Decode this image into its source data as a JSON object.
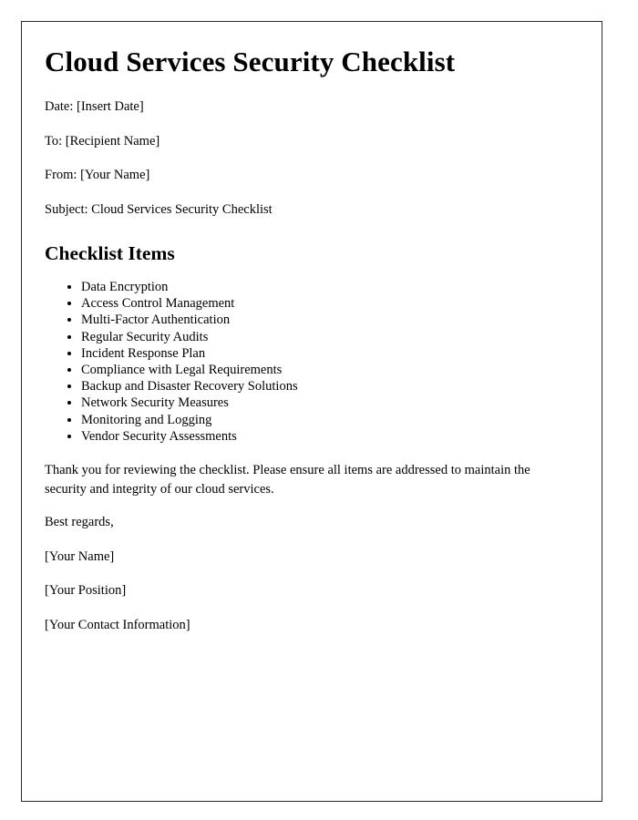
{
  "document": {
    "title": "Cloud Services Security Checklist",
    "meta_lines": [
      "Date: [Insert Date]",
      "To: [Recipient Name]",
      "From: [Your Name]",
      "Subject: Cloud Services Security Checklist"
    ],
    "section_heading": "Checklist Items",
    "checklist_items": [
      "Data Encryption",
      "Access Control Management",
      "Multi-Factor Authentication",
      "Regular Security Audits",
      "Incident Response Plan",
      "Compliance with Legal Requirements",
      "Backup and Disaster Recovery Solutions",
      "Network Security Measures",
      "Monitoring and Logging",
      "Vendor Security Assessments"
    ],
    "closing_paragraph": "Thank you for reviewing the checklist. Please ensure all items are addressed to maintain the security and integrity of our cloud services.",
    "signature": {
      "salutation": "Best regards,",
      "name": "[Your Name]",
      "position": "[Your Position]",
      "contact": "[Your Contact Information]"
    }
  },
  "style": {
    "text_color": "#000000",
    "border_color": "#2b2b2b",
    "page_background": "#ffffff"
  }
}
